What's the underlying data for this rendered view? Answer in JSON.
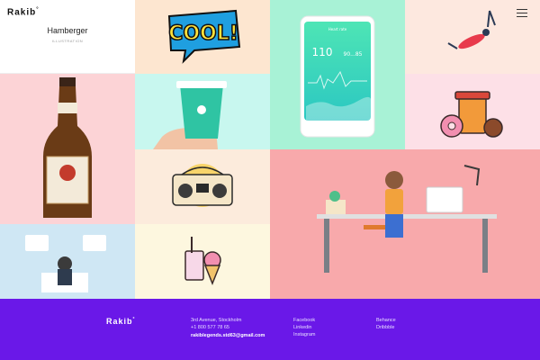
{
  "header": {
    "brand": "Rakib",
    "brand_mark": "°",
    "project_title": "Hamberger",
    "project_subtitle": "ILLUSTRATION",
    "menu_icon": "hamburger-menu-icon"
  },
  "tiles": {
    "cool_text": "COOL!",
    "phone": {
      "header": "Heart rate",
      "value_left": "110",
      "value_right": "90...85"
    }
  },
  "footer": {
    "brand": "Rakib",
    "brand_mark": "°",
    "address_line": "3rd Avenue, Stockholm",
    "phone": "+1 800 577 78 65",
    "email": "rakiblegends.std63@gmail.com",
    "social_left": [
      "Facebook",
      "Linkedin",
      "Instagram"
    ],
    "social_right": [
      "Behance",
      "Dribbble"
    ],
    "background_color": "#6a18e8"
  }
}
